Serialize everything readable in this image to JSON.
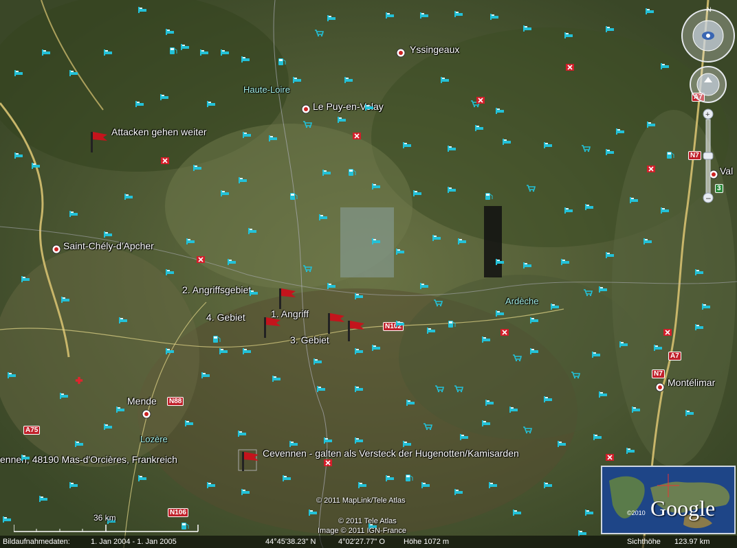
{
  "places": {
    "yssingeaux": "Yssingeaux",
    "haute_loire": "Haute-Loire",
    "le_puy": "Le Puy-en-Velay",
    "saint_chely": "Saint-Chély-d'Apcher",
    "ardeche": "Ardèche",
    "mende": "Mende",
    "lozere": "Lozère",
    "montelimar": "Montélimar",
    "valence_partial": "Val"
  },
  "markers": {
    "attacken": "Attacken gehen weiter",
    "angriffsgebiet2": "2. Angriffsgebiet",
    "gebiet4": "4. Gebiet",
    "angriff1": "1. Angriff",
    "gebiet3": "3. Gebiet",
    "cevennen": "Cevennen - galten als Versteck der Hugenotten/Kamisarden",
    "address": "ennen, 48190 Mas-d'Orcières, Frankreich"
  },
  "roads": {
    "n102": "N102",
    "n88": "N88",
    "a75": "A75",
    "n106": "N106",
    "a7": "A7",
    "n7": "N7",
    "a7b": "A7",
    "n7b": "N7",
    "n3": "3"
  },
  "copyrights": {
    "maplink": "© 2011 MapLink/Tele Atlas",
    "teleatlas": "© 2011 Tele Atlas",
    "image": "Image © 2011 IGN-France"
  },
  "status": {
    "date_label": "Bildaufnahmedaten:",
    "date_range": "1. Jan 2004 - 1. Jan 2005",
    "lat": "44°45'38.23\" N",
    "lon": "4°02'27.77\" O",
    "height": "Höhe 1072 m",
    "eye_alt_label": "Sichthöhe",
    "eye_alt": "123.97 km"
  },
  "scale": {
    "label": "36 km"
  },
  "logo": {
    "name": "Google",
    "year": "©2010"
  },
  "colors": {
    "terrain": "#4c5a35",
    "river": "#c8b66a",
    "flag": "#c4141c",
    "poi": "#23c1d8"
  }
}
